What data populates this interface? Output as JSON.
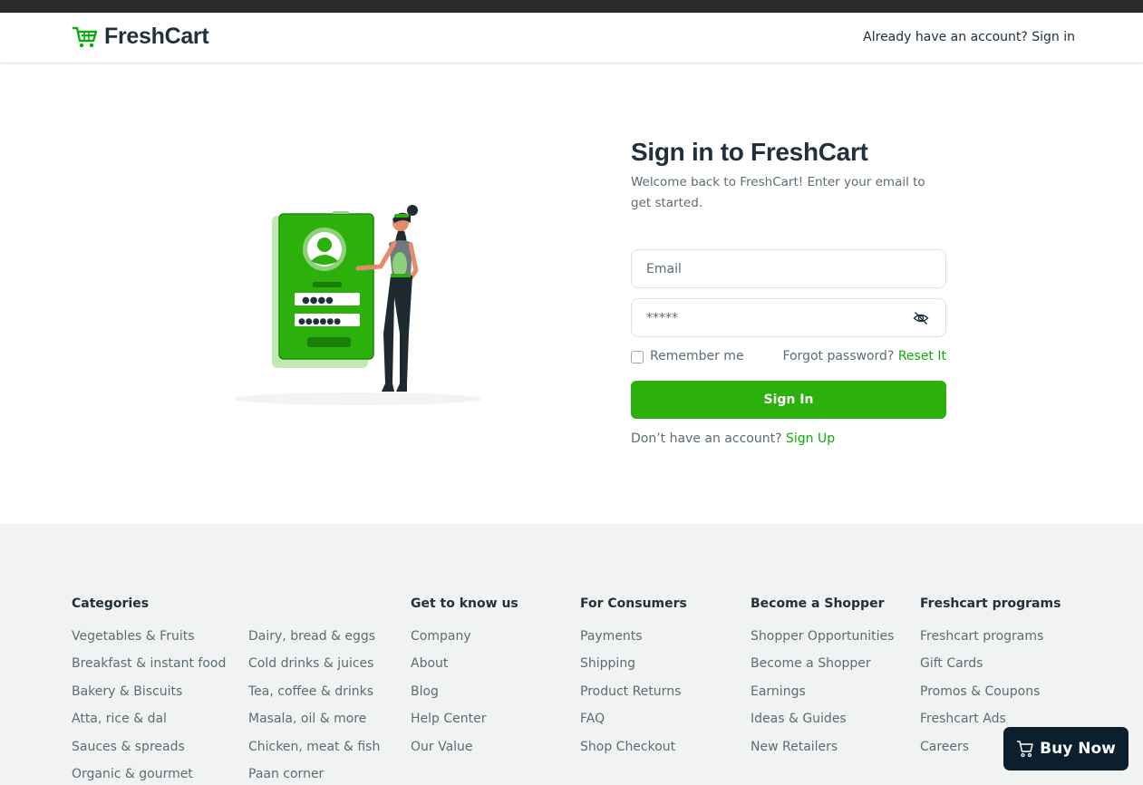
{
  "brand": {
    "name": "FreshCart",
    "accent": "#0aad0a",
    "button_color": "#2cb00b"
  },
  "header": {
    "prompt": "Already have an account?",
    "link": "Sign in"
  },
  "signin": {
    "title": "Sign in to FreshCart",
    "subtitle": "Welcome back to FreshCart! Enter your email to get started.",
    "email_placeholder": "Email",
    "password_value": "*****",
    "remember_label": "Remember me",
    "forgot_prompt": "Forgot password?",
    "forgot_link": "Reset It",
    "submit_label": "Sign In",
    "no_account_prompt": "Don’t have an account?",
    "signup_link": "Sign Up"
  },
  "footer": {
    "categories": {
      "title": "Categories",
      "col1": [
        "Vegetables & Fruits",
        "Breakfast & instant food",
        "Bakery & Biscuits",
        "Atta, rice & dal",
        "Sauces & spreads",
        "Organic & gourmet"
      ],
      "col2": [
        "Dairy, bread & eggs",
        "Cold drinks & juices",
        "Tea, coffee & drinks",
        "Masala, oil & more",
        "Chicken, meat & fish",
        "Paan corner"
      ]
    },
    "know_us": {
      "title": "Get to know us",
      "items": [
        "Company",
        "About",
        "Blog",
        "Help Center",
        "Our Value"
      ]
    },
    "consumers": {
      "title": "For Consumers",
      "items": [
        "Payments",
        "Shipping",
        "Product Returns",
        "FAQ",
        "Shop Checkout"
      ]
    },
    "shopper": {
      "title": "Become a Shopper",
      "items": [
        "Shopper Opportunities",
        "Become a Shopper",
        "Earnings",
        "Ideas & Guides",
        "New Retailers"
      ]
    },
    "programs": {
      "title": "Freshcart programs",
      "items": [
        "Freshcart programs",
        "Gift Cards",
        "Promos & Coupons",
        "Freshcart Ads",
        "Careers"
      ]
    }
  },
  "buy_now": {
    "label": "Buy Now",
    "icon": "cart-icon"
  }
}
